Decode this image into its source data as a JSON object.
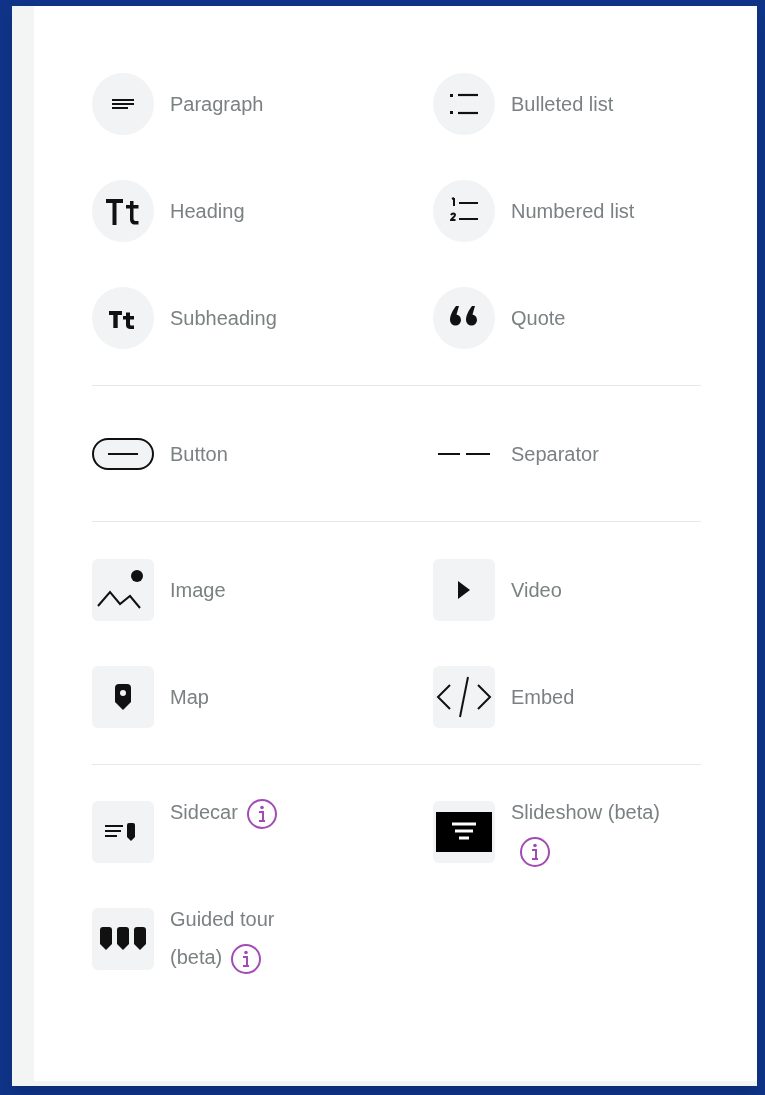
{
  "sections": [
    {
      "kind": "circle",
      "items": [
        {
          "kind": "paragraph",
          "label": "Paragraph",
          "info": false
        },
        {
          "kind": "bulleted",
          "label": "Bulleted list",
          "info": false
        },
        {
          "kind": "heading",
          "label": "Heading",
          "info": false
        },
        {
          "kind": "numbered",
          "label": "Numbered list",
          "info": false
        },
        {
          "kind": "subheading",
          "label": "Subheading",
          "info": false
        },
        {
          "kind": "quote",
          "label": "Quote",
          "info": false
        }
      ]
    },
    {
      "kind": "none",
      "items": [
        {
          "kind": "button",
          "label": "Button",
          "info": false
        },
        {
          "kind": "separator",
          "label": "Separator",
          "info": false
        }
      ]
    },
    {
      "kind": "square",
      "items": [
        {
          "kind": "image",
          "label": "Image",
          "info": false
        },
        {
          "kind": "video",
          "label": "Video",
          "info": false
        },
        {
          "kind": "map",
          "label": "Map",
          "info": false
        },
        {
          "kind": "embed",
          "label": "Embed",
          "info": false
        }
      ]
    },
    {
      "kind": "square",
      "items": [
        {
          "kind": "sidecar",
          "label": "Sidecar",
          "info": true
        },
        {
          "kind": "slideshow",
          "label": "Slideshow (beta)",
          "info": true
        },
        {
          "kind": "guided",
          "label": "Guided tour (beta)",
          "info": true
        }
      ]
    }
  ]
}
